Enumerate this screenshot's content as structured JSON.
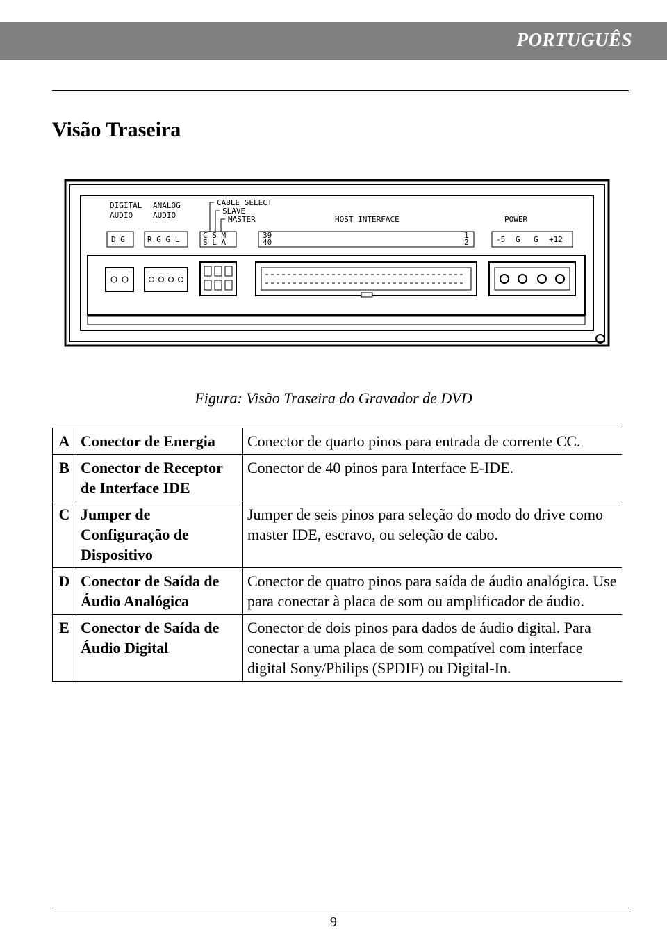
{
  "header": {
    "language": "PORTUGUÊS"
  },
  "section": {
    "title": "Visão Traseira"
  },
  "figure": {
    "caption": "Figura: Visão Traseira do Gravador de DVD",
    "labels": {
      "digital": "DIGITAL",
      "analog": "ANALOG",
      "audio1": "AUDIO",
      "audio2": "AUDIO",
      "cable_select": "CABLE SELECT",
      "slave": "SLAVE",
      "master": "MASTER",
      "host_interface": "HOST INTERFACE",
      "power": "POWER",
      "dg": "D G",
      "rggl": "R G G L",
      "csm": "C S M",
      "sla": "S L A",
      "pin39": "39",
      "pin40": "40",
      "pin1": "1",
      "pin2": "2",
      "pwr_minus5": "-5",
      "pwr_g1": "G",
      "pwr_g2": "G",
      "pwr_plus12": "+12"
    }
  },
  "table": {
    "rows": [
      {
        "letter": "A",
        "name": "Conector de Energia",
        "desc": "Conector de quarto pinos para entrada de corrente CC."
      },
      {
        "letter": "B",
        "name": "Conector de Receptor de Interface IDE",
        "desc": "Conector de 40 pinos para Interface E-IDE."
      },
      {
        "letter": "C",
        "name": "Jumper de Configuração de Dispositivo",
        "desc": "Jumper de seis pinos para seleção do modo do drive como master IDE, escravo, ou seleção de cabo."
      },
      {
        "letter": "D",
        "name": "Conector de Saída de Áudio Analógica",
        "desc": "Conector de quatro pinos para saída de áudio analógica. Use para conectar à placa de som ou amplificador de áudio."
      },
      {
        "letter": "E",
        "name": "Conector de Saída de Áudio Digital",
        "desc": "Conector de dois pinos para dados de áudio digital. Para conectar a uma placa de som compatível com interface digital Sony/Philips (SPDIF) ou Digital-In."
      }
    ]
  },
  "page": {
    "number": "9"
  }
}
